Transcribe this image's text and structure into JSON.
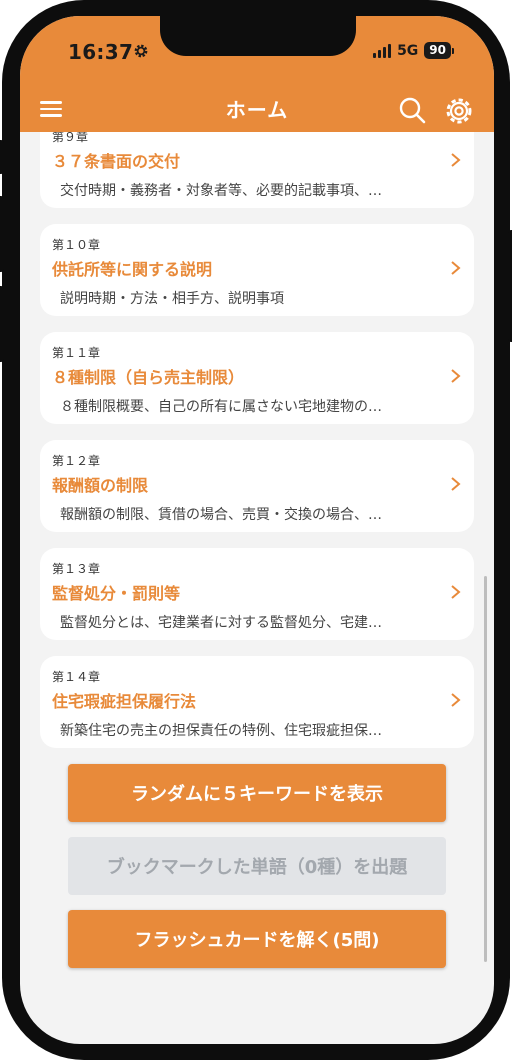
{
  "status_bar": {
    "time": "16:37",
    "network": "5G",
    "battery": "90"
  },
  "nav": {
    "title": "ホーム"
  },
  "chapters": [
    {
      "chapter": "第９章",
      "title": "３７条書面の交付",
      "desc": "交付時期・義務者・対象者等、必要的記載事項、…"
    },
    {
      "chapter": "第１０章",
      "title": "供託所等に関する説明",
      "desc": "説明時期・方法・相手方、説明事項"
    },
    {
      "chapter": "第１１章",
      "title": "８種制限（自ら売主制限）",
      "desc": "８種制限概要、自己の所有に属さない宅地建物の…"
    },
    {
      "chapter": "第１２章",
      "title": "報酬額の制限",
      "desc": "報酬額の制限、賃借の場合、売買・交換の場合、…"
    },
    {
      "chapter": "第１３章",
      "title": "監督処分・罰則等",
      "desc": "監督処分とは、宅建業者に対する監督処分、宅建…"
    },
    {
      "chapter": "第１４章",
      "title": "住宅瑕疵担保履行法",
      "desc": "新築住宅の売主の担保責任の特例、住宅瑕疵担保…"
    }
  ],
  "actions": {
    "random_label": "ランダムに５キーワードを表示",
    "bookmark_label": "ブックマークした単語（0種）を出題",
    "flashcard_label": "フラッシュカードを解く(5問)"
  },
  "colors": {
    "accent": "#e88a3a",
    "disabled_bg": "#e2e4e7",
    "disabled_text": "#a3a8ae"
  }
}
